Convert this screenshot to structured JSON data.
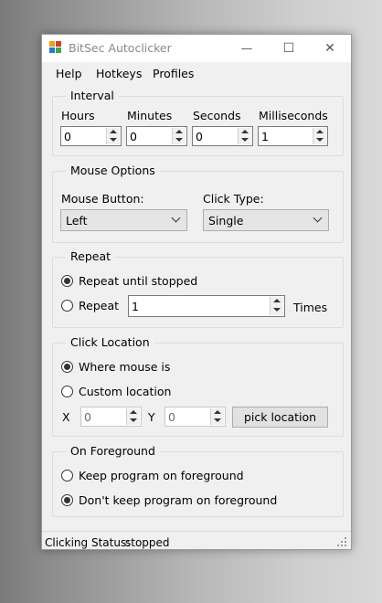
{
  "window": {
    "title": "BitSec Autoclicker",
    "controls": {
      "minimize": "—",
      "maximize": "☐",
      "close": "✕"
    }
  },
  "menu": {
    "items": [
      "Help",
      "Hotkeys",
      "Profiles"
    ]
  },
  "interval": {
    "legend": "Interval",
    "fields": [
      {
        "label": "Hours",
        "value": "0"
      },
      {
        "label": "Minutes",
        "value": "0"
      },
      {
        "label": "Seconds",
        "value": "0"
      },
      {
        "label": "Milliseconds",
        "value": "1"
      }
    ]
  },
  "mouse_options": {
    "legend": "Mouse Options",
    "button_label": "Mouse Button:",
    "button_value": "Left",
    "click_type_label": "Click Type:",
    "click_type_value": "Single"
  },
  "repeat": {
    "legend": "Repeat",
    "until_stopped_label": "Repeat until stopped",
    "until_stopped_selected": true,
    "repeat_label": "Repeat",
    "repeat_selected": false,
    "times_value": "1",
    "times_label": "Times"
  },
  "click_location": {
    "legend": "Click Location",
    "where_mouse_label": "Where mouse is",
    "where_mouse_selected": true,
    "custom_label": "Custom location",
    "custom_selected": false,
    "x_label": "X",
    "x_value": "0",
    "y_label": "Y",
    "y_value": "0",
    "pick_button": "pick location"
  },
  "foreground": {
    "legend": "On Foreground",
    "keep_label": "Keep program on foreground",
    "keep_selected": false,
    "dont_keep_label": "Don't keep program on foreground",
    "dont_keep_selected": true
  },
  "status": {
    "label": "Clicking Status:",
    "value": "stopped"
  },
  "colors": {
    "window_bg": "#f0f0f0",
    "title_text": "#8a8a8a",
    "group_border": "#dcdcdc"
  }
}
